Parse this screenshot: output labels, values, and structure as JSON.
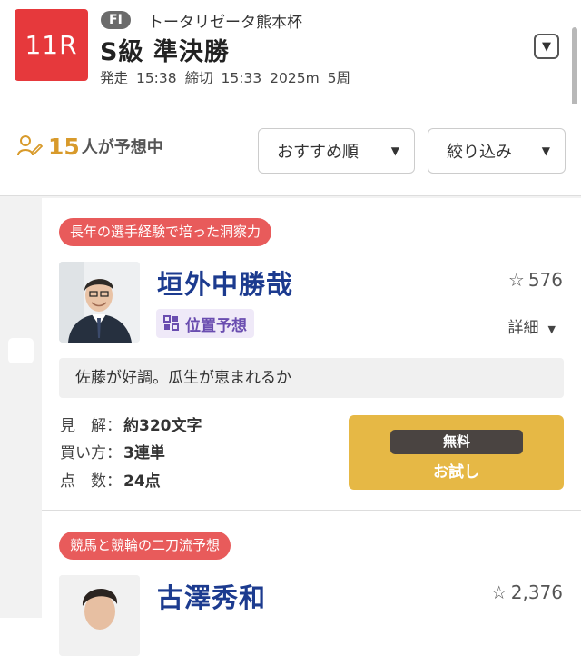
{
  "header": {
    "race_number": "11R",
    "grade": "FI",
    "event_name": "トータリゼータ熊本杯",
    "race_title": "S級 準決勝",
    "start_label": "発走",
    "start_time": "15:38",
    "deadline_label": "締切",
    "deadline_time": "15:33",
    "distance": "2025m",
    "laps": "5周",
    "dropdown_icon": "chevron-down-icon"
  },
  "filter": {
    "count": "15",
    "count_suffix": "人が予想中",
    "sort_label": "おすすめ順",
    "filter_label": "絞り込み"
  },
  "cards": [
    {
      "tag": "長年の選手経験で培った洞察力",
      "name": "垣外中勝哉",
      "stars": "576",
      "badge": "位置予想",
      "detail": "詳細",
      "comment": "佐藤が好調。瓜生が恵まれるか",
      "meta": [
        {
          "key": "見　解：",
          "value": "約320文字"
        },
        {
          "key": "買い方：",
          "value": "3連単"
        },
        {
          "key": "点　数：",
          "value": "24点"
        }
      ],
      "try_top": "無料",
      "try_bottom": "お試し"
    },
    {
      "tag": "競馬と競輪の二刀流予想",
      "name": "古澤秀和",
      "stars": "2,376"
    }
  ],
  "colors": {
    "race_badge": "#e6393c",
    "tag": "#e85b5b",
    "name": "#1c3b8f",
    "count": "#d89a2b",
    "try_button": "#e6b845"
  }
}
